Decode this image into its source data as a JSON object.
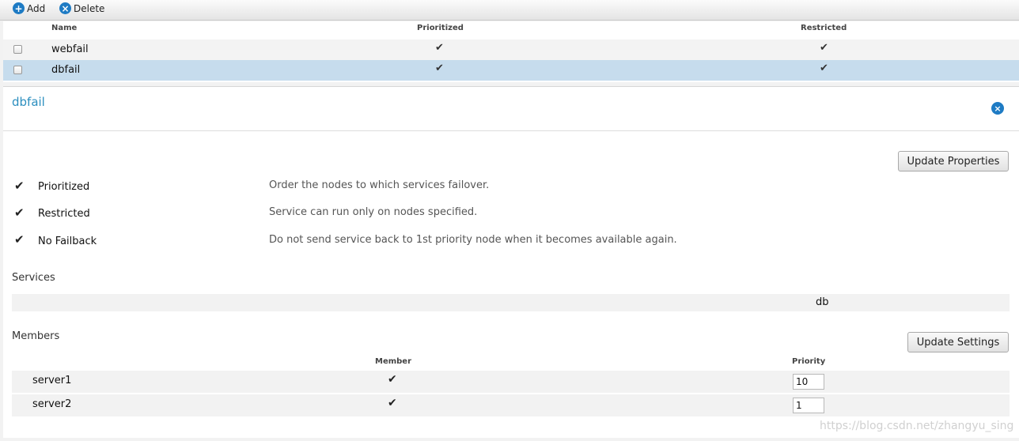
{
  "toolbar": {
    "add_label": "Add",
    "delete_label": "Delete"
  },
  "list": {
    "columns": [
      "Name",
      "Prioritized",
      "Restricted"
    ],
    "rows": [
      {
        "name": "webfail",
        "prioritized": "✔",
        "restricted": "✔",
        "selected": false
      },
      {
        "name": "dbfail",
        "prioritized": "✔",
        "restricted": "✔",
        "selected": true
      }
    ]
  },
  "detail": {
    "title": "dbfail",
    "close_icon": "×",
    "update_properties_label": "Update Properties",
    "properties": [
      {
        "label": "Prioritized",
        "description": "Order the nodes to which services failover.",
        "checked": "✔"
      },
      {
        "label": "Restricted",
        "description": "Service can run only on nodes specified.",
        "checked": "✔"
      },
      {
        "label": "No Failback",
        "description": "Do not send service back to 1st priority node when it becomes available again.",
        "checked": "✔"
      }
    ],
    "services_label": "Services",
    "services": [
      "db"
    ],
    "members_label": "Members",
    "update_settings_label": "Update Settings",
    "member_columns": [
      "Member",
      "Priority"
    ],
    "members": [
      {
        "name": "server1",
        "member": "✔",
        "priority": "10"
      },
      {
        "name": "server2",
        "member": "✔",
        "priority": "1"
      }
    ]
  },
  "watermark": "https://blog.csdn.net/zhangyu_sing",
  "colors": {
    "accent": "#1e7bc4",
    "title": "#2c8fbf",
    "selected_row": "#c6dced"
  }
}
